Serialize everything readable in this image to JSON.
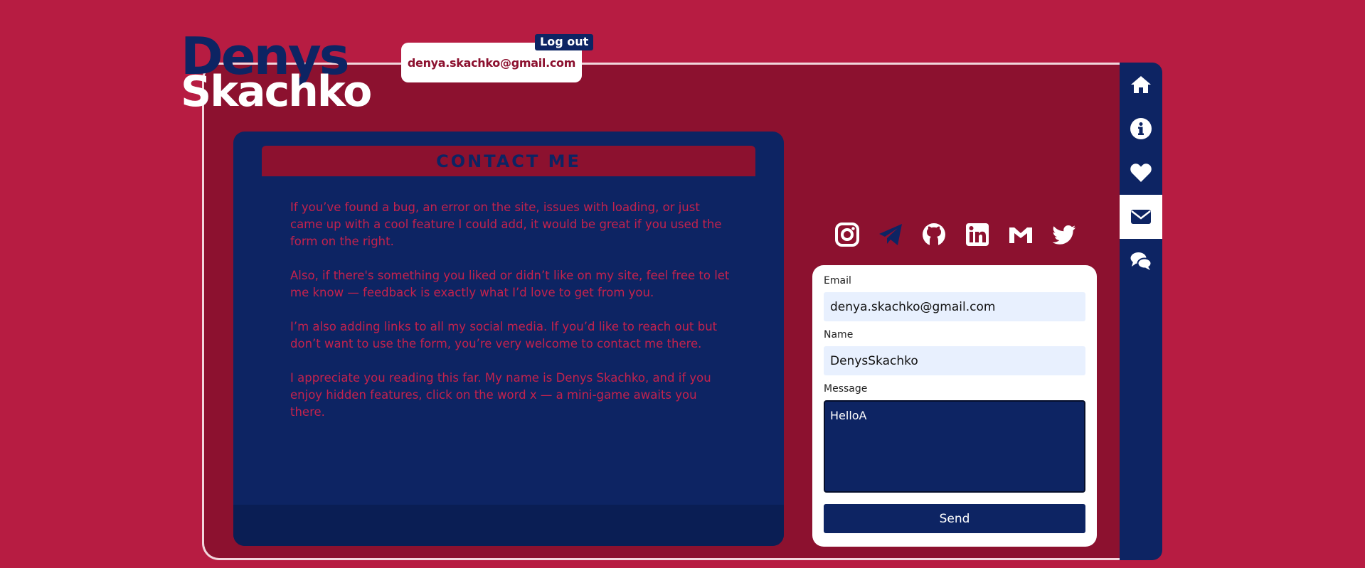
{
  "logo": {
    "first": "Denys",
    "last": "Skachko"
  },
  "user": {
    "email": "denya.skachko@gmail.com",
    "logout_label": "Log out"
  },
  "contact": {
    "title": "Contact me",
    "paragraphs": [
      "If you’ve found a bug, an error on the site, issues with loading, or just came up with a cool feature I could add, it would be great if you used the form on the right.",
      "Also, if there's something you liked or didn’t like on my site, feel free to let me know — feedback is exactly what I’d love to get from you.",
      "I’m also adding links to all my social media. If you’d like to reach out but don’t want to use the form, you’re very welcome to contact me there.",
      "I appreciate you reading this far. My name is Denys Skachko, and if you enjoy hidden features, click on the word x — a mini-game awaits you there."
    ]
  },
  "socials": [
    "instagram-icon",
    "telegram-icon",
    "github-icon",
    "linkedin-icon",
    "gmail-icon",
    "twitter-icon"
  ],
  "form": {
    "email_label": "Email",
    "email_value": "denya.skachko@gmail.com",
    "name_label": "Name",
    "name_value": "DenysSkachko",
    "message_label": "Message",
    "message_value": "HelloA",
    "send_label": "Send"
  },
  "nav": [
    "home-icon",
    "info-icon",
    "heart-icon",
    "mail-icon",
    "chat-icon"
  ],
  "active_nav": "mail-icon",
  "colors": {
    "background": "#b71c42",
    "frame": "#8c112f",
    "navy": "#0d2463",
    "text_accent": "#c4224d"
  }
}
